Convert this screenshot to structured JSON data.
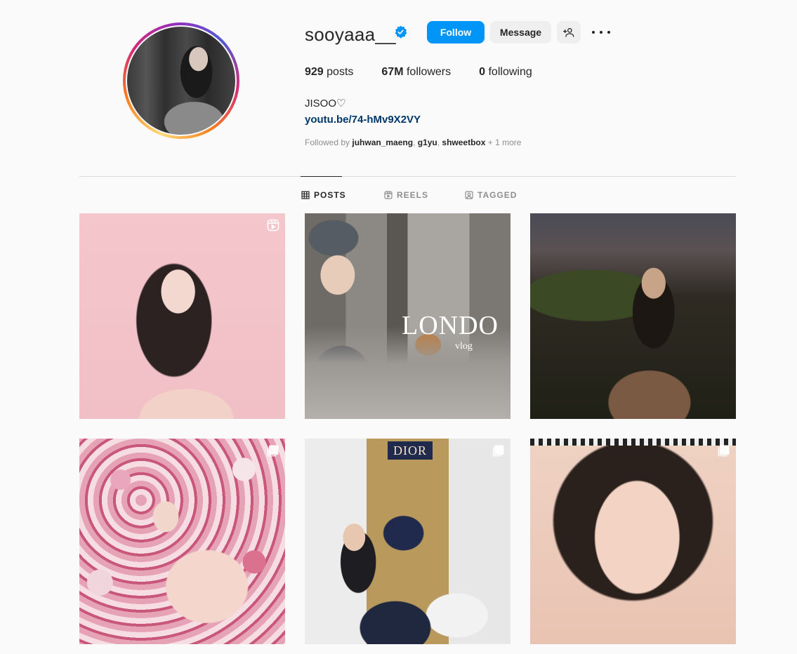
{
  "profile": {
    "username": "sooyaaa__",
    "verified": true,
    "follow_label": "Follow",
    "message_label": "Message",
    "stats": {
      "posts_count": "929",
      "posts_label": "posts",
      "followers_count": "67M",
      "followers_label": "followers",
      "following_count": "0",
      "following_label": "following"
    },
    "bio_name": "JISOO♡",
    "link": "youtu.be/74-hMv9X2VY",
    "followed_by": {
      "prefix": "Followed by",
      "users": [
        "juhwan_maeng",
        "g1yu",
        "shweetbox"
      ],
      "suffix": "+ 1 more"
    }
  },
  "tabs": [
    {
      "label": "POSTS",
      "icon": "grid-icon",
      "active": true
    },
    {
      "label": "REELS",
      "icon": "reels-icon",
      "active": false
    },
    {
      "label": "TAGGED",
      "icon": "tagged-icon",
      "active": false
    }
  ],
  "posts": [
    {
      "overlay": "reel-icon",
      "caption": ""
    },
    {
      "overlay": "",
      "caption": "LONDO",
      "subcaption": "vlog"
    },
    {
      "overlay": "",
      "caption": ""
    },
    {
      "overlay": "carousel-icon",
      "caption": ""
    },
    {
      "overlay": "carousel-icon",
      "caption": "DIOR"
    },
    {
      "overlay": "carousel-icon",
      "caption": ""
    }
  ],
  "colors": {
    "accent": "#0095f6",
    "link": "#00376b",
    "background": "#fafafa",
    "verified": "#0095f6"
  }
}
